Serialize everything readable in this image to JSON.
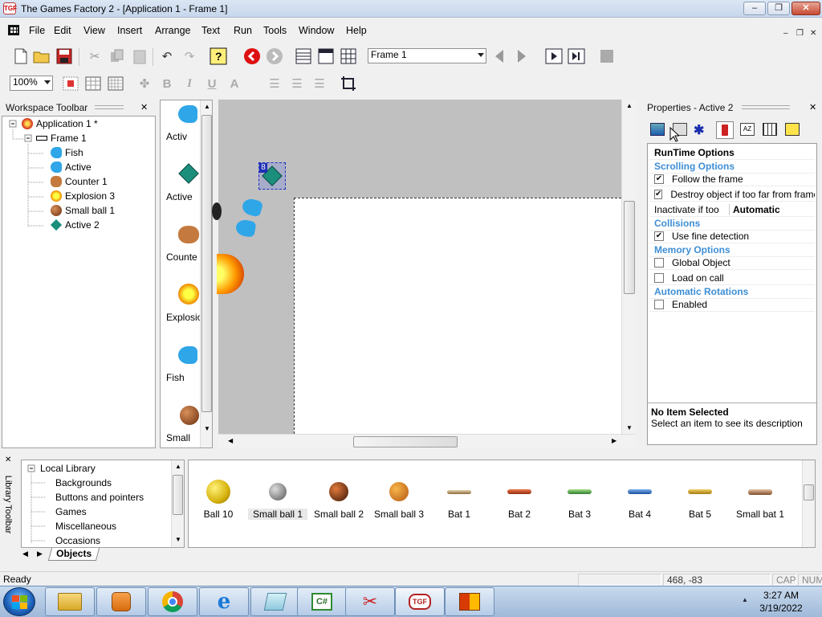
{
  "window": {
    "title": "The Games Factory 2 - [Application 1 - Frame 1]",
    "app_icon_text": "TGF",
    "min": "‒",
    "max": "❐",
    "close": "✕"
  },
  "menu": {
    "items": [
      "File",
      "Edit",
      "View",
      "Insert",
      "Arrange",
      "Text",
      "Run",
      "Tools",
      "Window",
      "Help"
    ],
    "mdi_min": "‒",
    "mdi_max": "❐",
    "mdi_close": "✕"
  },
  "toolbar": {
    "frame_select": "Frame 1",
    "zoom_select": "100%"
  },
  "workspace": {
    "title": "Workspace Toolbar",
    "close": "✕",
    "tree": [
      {
        "label": "Application 1 *",
        "icon": "application-icon",
        "level": 0
      },
      {
        "label": "Frame 1",
        "icon": "frame-icon",
        "level": 1
      },
      {
        "label": "Fish",
        "icon": "fish-icon",
        "level": 2
      },
      {
        "label": "Active",
        "icon": "fish-icon",
        "level": 2
      },
      {
        "label": "Counter 1",
        "icon": "pig-icon",
        "level": 2
      },
      {
        "label": "Explosion 3",
        "icon": "explosion-icon",
        "level": 2
      },
      {
        "label": "Small ball 1",
        "icon": "ball-icon",
        "level": 2
      },
      {
        "label": "Active 2",
        "icon": "diamond-icon",
        "level": 2
      }
    ]
  },
  "object_bar": {
    "items": [
      "Activ",
      "Active",
      "Counte",
      "Explosio",
      "Fish",
      "Small"
    ]
  },
  "editor": {
    "selected_badge": "8"
  },
  "properties": {
    "title": "Properties - Active 2",
    "close": "✕",
    "rows": [
      {
        "kind": "title",
        "text": "RunTime Options"
      },
      {
        "kind": "head",
        "text": "Scrolling Options"
      },
      {
        "kind": "check",
        "text": "Follow the frame",
        "checked": true
      },
      {
        "kind": "check",
        "text": "Destroy object if too far from frame",
        "checked": true
      },
      {
        "kind": "pair",
        "text": "Inactivate if too",
        "value": "Automatic"
      },
      {
        "kind": "head",
        "text": "Collisions"
      },
      {
        "kind": "check",
        "text": "Use fine detection",
        "checked": true
      },
      {
        "kind": "head",
        "text": "Memory Options"
      },
      {
        "kind": "check",
        "text": "Global Object",
        "checked": false
      },
      {
        "kind": "check",
        "text": "Load on call",
        "checked": false
      },
      {
        "kind": "head",
        "text": "Automatic Rotations"
      },
      {
        "kind": "check",
        "text": "Enabled",
        "checked": false
      }
    ],
    "desc_title": "No Item Selected",
    "desc_text": "Select an item to see its description"
  },
  "library": {
    "side_label": "Library Toolbar",
    "close": "✕",
    "root": "Local Library",
    "folders": [
      "Backgrounds",
      "Buttons and pointers",
      "Games",
      "Miscellaneous",
      "Occasions"
    ],
    "tab": "Objects",
    "items": [
      {
        "label": "Ball 10",
        "kind": "yellow-ball"
      },
      {
        "label": "Small ball 1",
        "kind": "gray-ball"
      },
      {
        "label": "Small ball 2",
        "kind": "dark-ball"
      },
      {
        "label": "Small ball 3",
        "kind": "cookie-ball"
      },
      {
        "label": "Bat 1",
        "kind": "bat"
      },
      {
        "label": "Bat 2",
        "kind": "bat"
      },
      {
        "label": "Bat 3",
        "kind": "bat"
      },
      {
        "label": "Bat 4",
        "kind": "bat"
      },
      {
        "label": "Bat 5",
        "kind": "bat"
      },
      {
        "label": "Small bat 1",
        "kind": "bat"
      }
    ]
  },
  "status": {
    "ready": "Ready",
    "coords": "468, -83",
    "cap": "CAP",
    "num": "NUM"
  },
  "taskbar": {
    "time": "3:27 AM",
    "date": "3/19/2022",
    "tray_arrow": "▲"
  },
  "colors": {
    "accent_head": "#3d8ed6",
    "editor_bg": "#c0c0c0"
  }
}
